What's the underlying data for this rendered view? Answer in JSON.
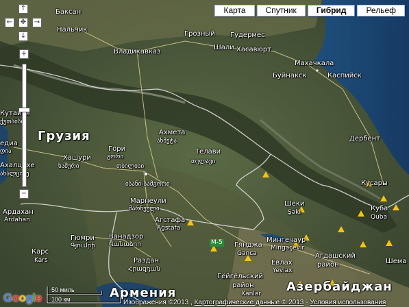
{
  "map_types": {
    "karta": "Карта",
    "sputnik": "Спутник",
    "gibrid": "Гибрид",
    "relef": "Рельеф",
    "active": "Гибрид"
  },
  "controls": {
    "up": "↑",
    "down": "↓",
    "left": "←",
    "right": "→",
    "center": "✥",
    "zoom_in": "+",
    "zoom_out": "−",
    "zoom_level_fraction": 0.63
  },
  "labels": {
    "baksan": "Баксан",
    "nalchik": "Нальчик",
    "vladikavkaz": "Владикавказ",
    "grozny": "Грозный",
    "gudermes": "Гудермес",
    "shali": "Шали",
    "khasavyurt": "Хасавюрт",
    "makhachkala": "Махачкала",
    "buynaksk": "Буйнакск",
    "kaspiysk": "Каспийск",
    "derbent": "Дербент",
    "kutaisi": "Кутаиси",
    "kutaisi_ge": "ქუთაისი",
    "georgia": "Грузия",
    "gori": "Гори",
    "gori_ge": "გორი",
    "akhmeta": "Ахмета",
    "akhmeta_ge": "ახმეტა",
    "telavi": "Телави",
    "telavi_ge": "თელავი",
    "khashuri": "Хашури",
    "khashuri_ge": "ხაშური",
    "tbilisi_ge": "თბილისი",
    "samtskhe_ge": "ისანი-სამგორი",
    "marneuli": "Марнеули",
    "marneuli_ge": "მარნეული",
    "akhaltsikhe": "Ахалцихе",
    "akhaltsikhe_ge": "ახალციხე",
    "ardahan": "Ардахан",
    "ardahan_lat": "Ardahan",
    "edia": "едиа",
    "edia_ge": "დია",
    "sheki": "Шеки",
    "sheki_lat": "Şəki",
    "kusary": "Кусары",
    "kuba": "Куба",
    "kuba_lat": "Quba",
    "agstafa": "Агстафа",
    "agstafa_lat": "Ağstafa",
    "mingachevir": "Мингечаур",
    "mingachevir_lat": "Mingəçevir",
    "agdash": "Агдашский",
    "agdash2": "район",
    "ganja": "Гянджа",
    "ganja_lat": "Gəncə",
    "evlakh": "Евлах",
    "evlakh_lat": "Yevlax",
    "geygel": "Гёйгёльский",
    "geygel2": "район",
    "gyumri": "Гюмри",
    "gyumri_am": "Գյումրի",
    "vanadzor": "Ванадзор",
    "vanadzor_am": "Վանաձոր",
    "razdan": "Раздан",
    "razdan_am": "Հրազդան",
    "kars": "Карс",
    "kars_lat": "Kars",
    "armenia": "Армения",
    "azerbaijan": "Азербайджан",
    "shema": "Шема",
    "m5": "M-5",
    "xanlar": "Xanlar"
  },
  "scale": {
    "miles": "50 миль",
    "km": "100 км"
  },
  "attribution": {
    "imagery": "Изображения ©2013 ,",
    "cartography": "Картографические данные © 2013",
    "separator": "-",
    "terms": "Условия использования"
  },
  "logo": {
    "letters": [
      "G",
      "o",
      "o",
      "g",
      "l",
      "e"
    ],
    "colors": [
      "#4b7ad8",
      "#d9382f",
      "#f3c012",
      "#4b7ad8",
      "#30a64a",
      "#d9382f"
    ]
  },
  "colors": {
    "sea": "#1d4a7a",
    "marker": "#f4c414",
    "border": "#d9d9d9"
  }
}
